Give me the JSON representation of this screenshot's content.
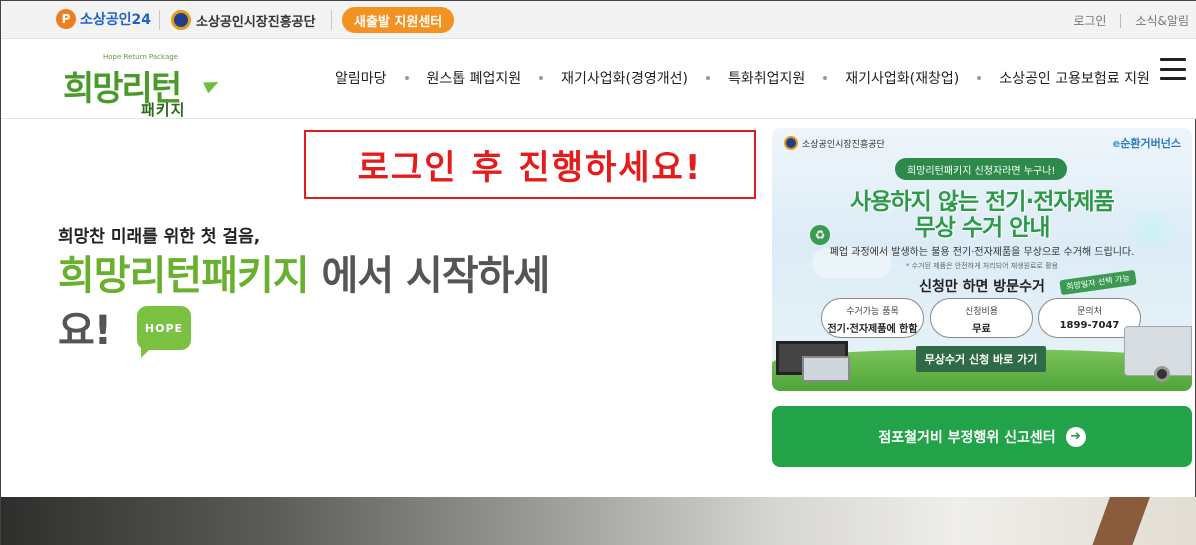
{
  "topbar": {
    "brand1": "소상공인24",
    "brand1_icon": "P",
    "brand2": "소상공인시장진흥공단",
    "startup_center_button": "새출발 지원센터",
    "login": "로그인",
    "news": "소식&알림"
  },
  "header": {
    "logo": {
      "subtitle": "Hope Return Package",
      "title": "희망리턴",
      "package": "패키지"
    },
    "nav": [
      "알림마당",
      "원스톱 폐업지원",
      "재기사업화(경영개선)",
      "특화취업지원",
      "재기사업화(재창업)",
      "소상공인 고용보험료 지원"
    ]
  },
  "notice": "로그인 후 진행하세요!",
  "hero": {
    "small": "희망찬 미래를 위한 첫 걸음,",
    "highlight": "희망리턴패키지",
    "rest_line1": " 에서 시작하세",
    "line2": "요!",
    "badge": "HOPE"
  },
  "banner": {
    "org": "소상공인시장진흥공단",
    "partner_e": "e",
    "partner": "순환거버넌스",
    "pill": "희망리턴패키지 신청자라면 누구나!",
    "headline1": "사용하지 않는 전기·전자제품",
    "headline2": "무상 수거 안내",
    "description": "폐업 과정에서 발생하는 불용 전기·전자제품을 무상으로 수거해 드립니다.",
    "note": "* 수거된 제품은 안전하게 처리되어 재생원료로 활용",
    "visit": "신청만 하면 방문수거",
    "tag": "희망일자 선택 가능",
    "info": [
      {
        "label": "수거가능 품목",
        "value": "전기·전자제품에 한함"
      },
      {
        "label": "신청비용",
        "value": "무료"
      },
      {
        "label": "문의처",
        "value": "1899-7047"
      }
    ],
    "cta": "무상수거 신청 바로 가기"
  },
  "report_button": "점포철거비 부정행위 신고센터",
  "colors": {
    "accent_orange": "#f39221",
    "brand_green": "#6ab02f",
    "report_green": "#22a34a",
    "notice_red": "#e51c1c"
  }
}
